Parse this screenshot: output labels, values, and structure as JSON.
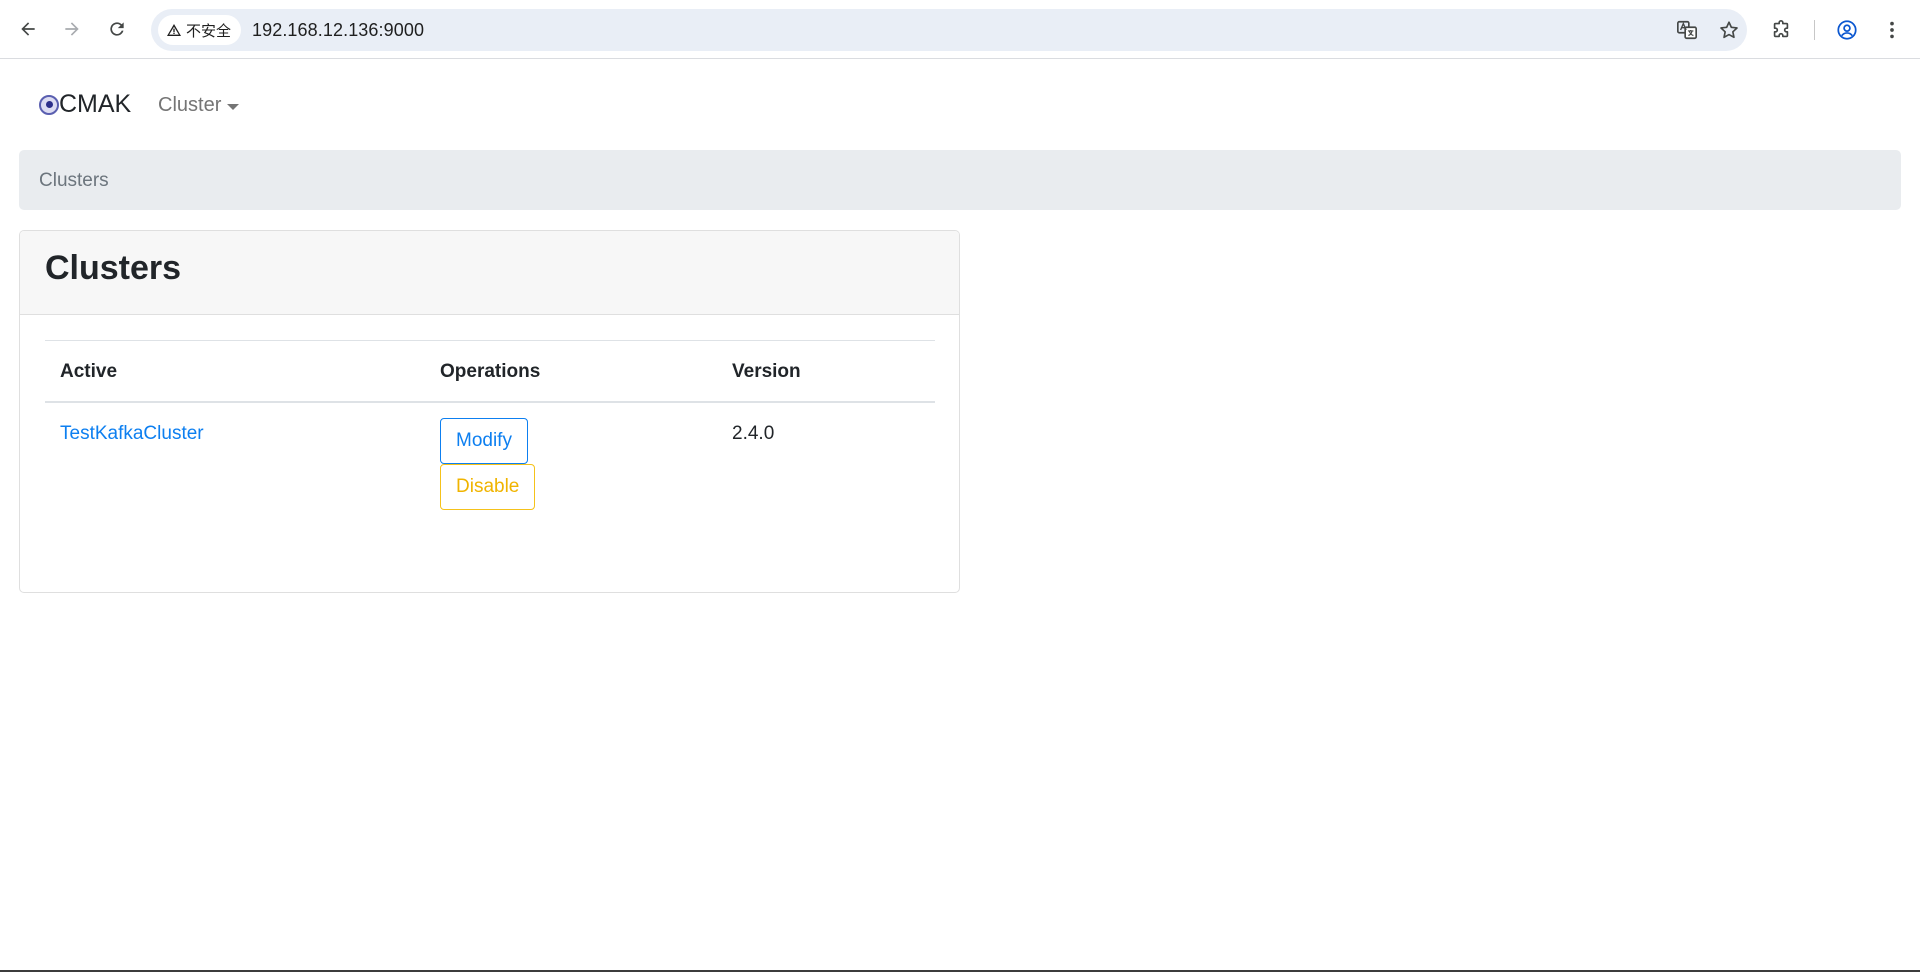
{
  "browser": {
    "security_label": "不安全",
    "url": "192.168.12.136:9000"
  },
  "navbar": {
    "brand": "CMAK",
    "dropdown_label": "Cluster"
  },
  "breadcrumb": {
    "items": [
      "Clusters"
    ]
  },
  "card": {
    "title": "Clusters",
    "table": {
      "headers": [
        "Active",
        "Operations",
        "Version"
      ],
      "rows": [
        {
          "name": "TestKafkaCluster",
          "operations": [
            "Modify",
            "Disable"
          ],
          "version": "2.4.0"
        }
      ]
    }
  },
  "colors": {
    "link": "#0d7ff0",
    "modify_button": "#0d7ff0",
    "disable_button": "#f0b400",
    "breadcrumb_bg": "#e9ecef",
    "card_header_bg": "#f7f7f7"
  },
  "icons": {
    "back": "arrow-left-icon",
    "forward": "arrow-right-icon",
    "reload": "reload-icon",
    "security": "warning-triangle-icon",
    "translate": "translate-icon",
    "bookmark": "star-icon",
    "extensions": "puzzle-icon",
    "profile": "account-circle-icon",
    "menu": "kebab-menu-icon",
    "brand_logo": "cmak-logo-icon"
  }
}
